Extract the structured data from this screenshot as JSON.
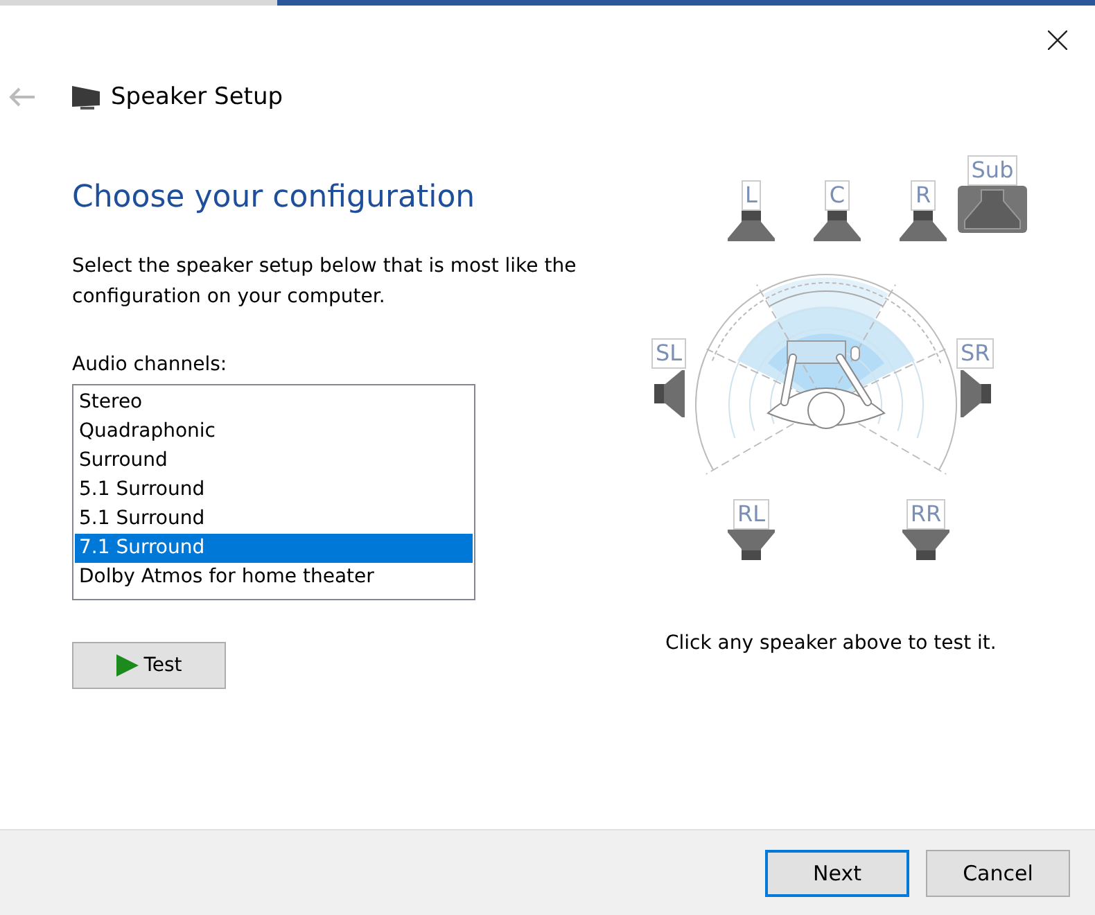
{
  "window": {
    "title": "Speaker Setup"
  },
  "heading": "Choose your configuration",
  "description": "Select the speaker setup below that is most like the configuration on your computer.",
  "channels_label": "Audio channels:",
  "channels": [
    {
      "label": "Stereo",
      "selected": false
    },
    {
      "label": "Quadraphonic",
      "selected": false
    },
    {
      "label": "Surround",
      "selected": false
    },
    {
      "label": "5.1 Surround",
      "selected": false
    },
    {
      "label": "5.1 Surround",
      "selected": false
    },
    {
      "label": "7.1 Surround",
      "selected": true
    },
    {
      "label": "Dolby Atmos for home theater",
      "selected": false
    }
  ],
  "test_button": "Test",
  "speakers": [
    {
      "label": "L",
      "kind": "front"
    },
    {
      "label": "C",
      "kind": "front"
    },
    {
      "label": "R",
      "kind": "front"
    },
    {
      "label": "Sub",
      "kind": "sub"
    },
    {
      "label": "SL",
      "kind": "side-left"
    },
    {
      "label": "SR",
      "kind": "side-right"
    },
    {
      "label": "RL",
      "kind": "rear"
    },
    {
      "label": "RR",
      "kind": "rear"
    }
  ],
  "hint": "Click any speaker above to test it.",
  "buttons": [
    {
      "label": "Next",
      "default": true
    },
    {
      "label": "Cancel",
      "default": false
    }
  ]
}
